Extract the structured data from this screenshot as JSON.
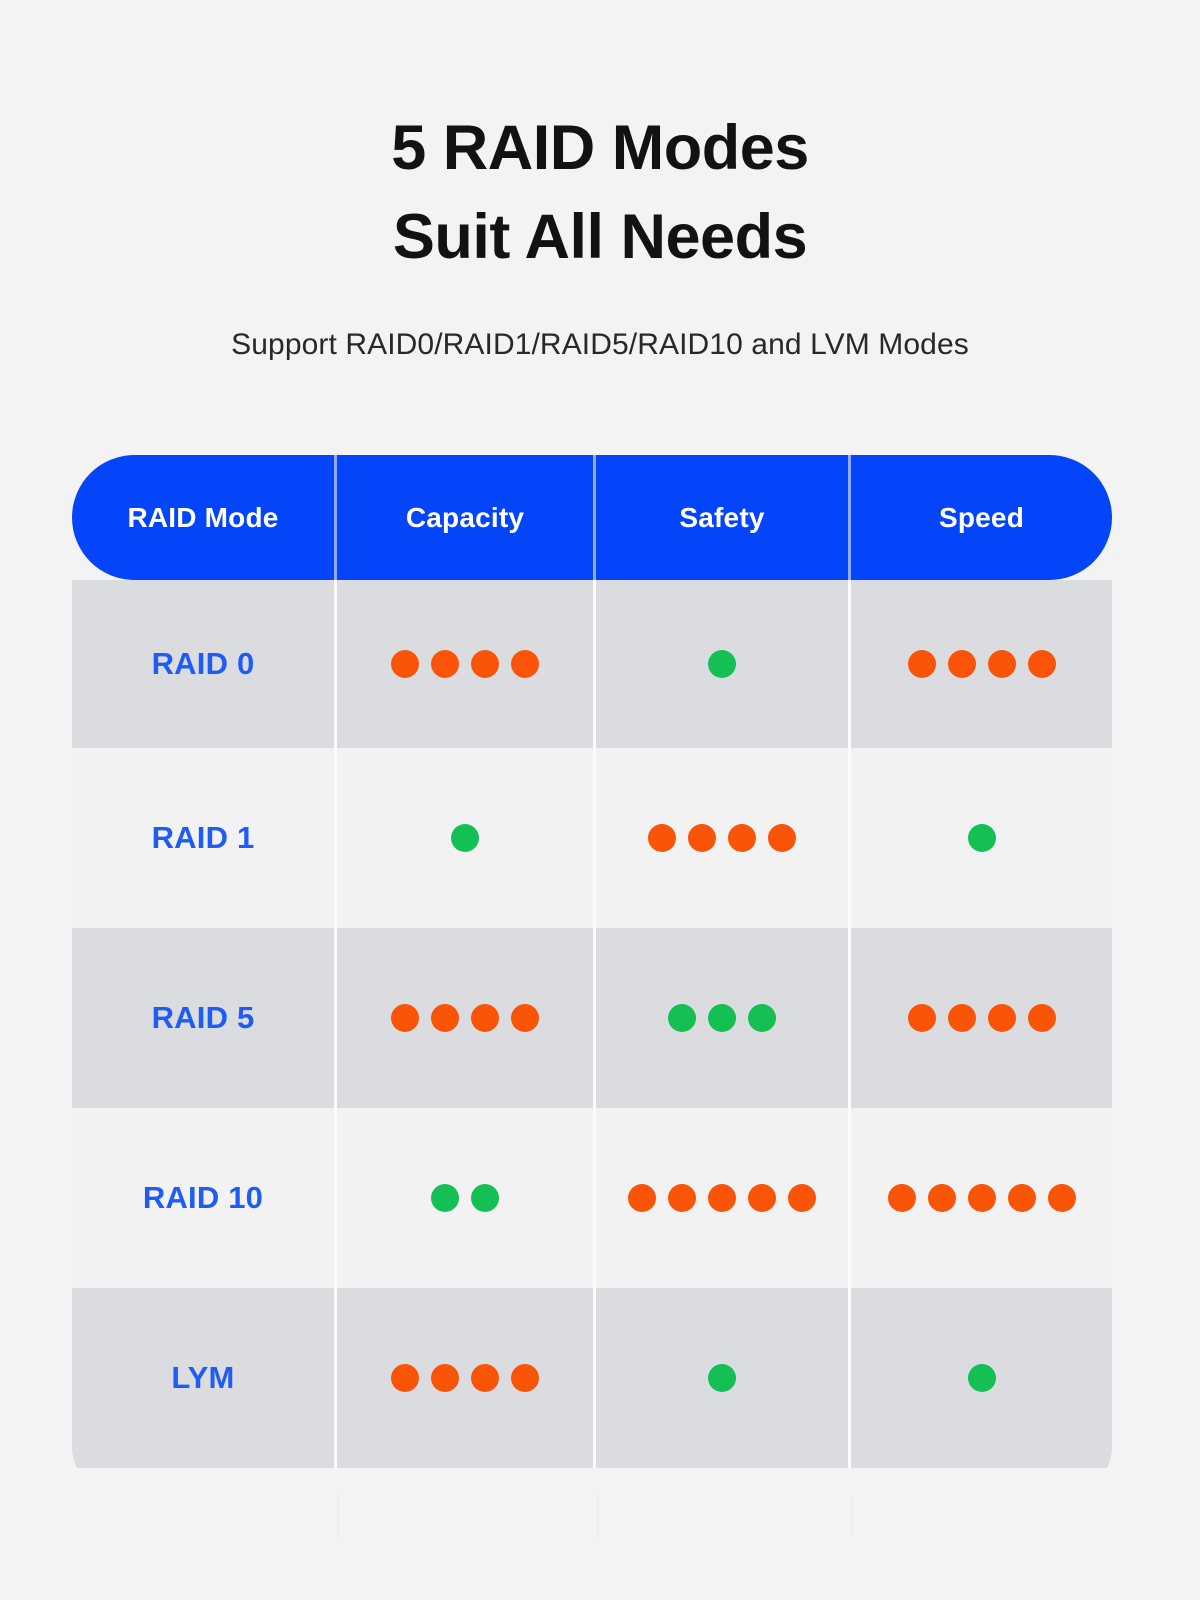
{
  "hero": {
    "title_line1": "5 RAID Modes",
    "title_line2": "Suit All Needs",
    "subtitle": "Support RAID0/RAID1/RAID5/RAID10 and LVM Modes"
  },
  "colors": {
    "background": "#f3f3f3",
    "header_blue": "#0545fa",
    "label_blue": "#1f5cf5",
    "dot_orange": "#fa5409",
    "dot_green": "#14c054",
    "row_dark": "#dbdce0",
    "row_light": "#f2f2f3",
    "title_black": "#111214"
  },
  "table": {
    "columns": [
      {
        "key": "mode",
        "label": "RAID Mode"
      },
      {
        "key": "capacity",
        "label": "Capacity"
      },
      {
        "key": "safety",
        "label": "Safety"
      },
      {
        "key": "speed",
        "label": "Speed"
      }
    ],
    "rows": [
      {
        "mode": "RAID 0",
        "capacity": {
          "count": 4,
          "color": "orange"
        },
        "safety": {
          "count": 1,
          "color": "green"
        },
        "speed": {
          "count": 4,
          "color": "orange"
        }
      },
      {
        "mode": "RAID 1",
        "capacity": {
          "count": 1,
          "color": "green"
        },
        "safety": {
          "count": 4,
          "color": "orange"
        },
        "speed": {
          "count": 1,
          "color": "green"
        }
      },
      {
        "mode": "RAID 5",
        "capacity": {
          "count": 4,
          "color": "orange"
        },
        "safety": {
          "count": 3,
          "color": "green"
        },
        "speed": {
          "count": 4,
          "color": "orange"
        }
      },
      {
        "mode": "RAID 10",
        "capacity": {
          "count": 2,
          "color": "green"
        },
        "safety": {
          "count": 5,
          "color": "orange"
        },
        "speed": {
          "count": 5,
          "color": "orange"
        }
      },
      {
        "mode": "LYM",
        "capacity": {
          "count": 4,
          "color": "orange"
        },
        "safety": {
          "count": 1,
          "color": "green"
        },
        "speed": {
          "count": 1,
          "color": "green"
        }
      }
    ]
  }
}
